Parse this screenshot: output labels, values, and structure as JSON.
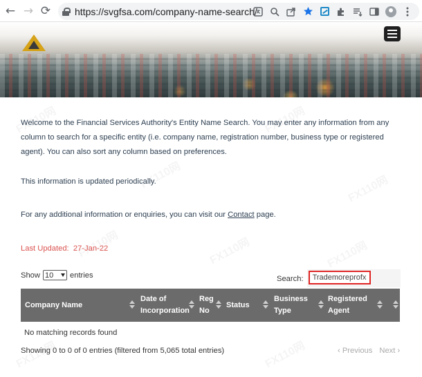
{
  "browser": {
    "url": "https://svgfsa.com/company-name-search/",
    "back_glyph": "←",
    "forward_glyph": "→",
    "reload_glyph": "⟳"
  },
  "intro": {
    "text": "Welcome to the Financial Services Authority's Entity Name Search. You may enter any information from any column to search for a specific entity (i.e. company name, registration number, business type or registered agent). You can also sort any column based on preferences."
  },
  "updated_note": "This information is updated periodically.",
  "contact": {
    "prefix": "For any additional information or enquiries, you can visit our ",
    "link": "Contact",
    "suffix": " page."
  },
  "last_updated": {
    "label": "Last Updated:",
    "date": "27-Jan-22",
    "color": "#d9534f"
  },
  "table_controls": {
    "show_label": "Show",
    "page_size": "10",
    "entries_label": "entries",
    "search_label": "Search:",
    "search_value": "Trademoreprofx"
  },
  "table": {
    "columns": [
      {
        "label_line1": "Company Name",
        "label_line2": ""
      },
      {
        "label_line1": "Date of",
        "label_line2": "Incorporation"
      },
      {
        "label_line1": "Reg",
        "label_line2": "No"
      },
      {
        "label_line1": "Status",
        "label_line2": ""
      },
      {
        "label_line1": "Business",
        "label_line2": "Type"
      },
      {
        "label_line1": "Registered",
        "label_line2": "Agent"
      }
    ],
    "empty_message": "No matching records found",
    "header_color": "#6b6b6b"
  },
  "footer": {
    "info": "Showing 0 to 0 of 0 entries (filtered from 5,065 total entries)",
    "previous": "Previous",
    "next": "Next"
  },
  "watermark_text": "FX110网"
}
